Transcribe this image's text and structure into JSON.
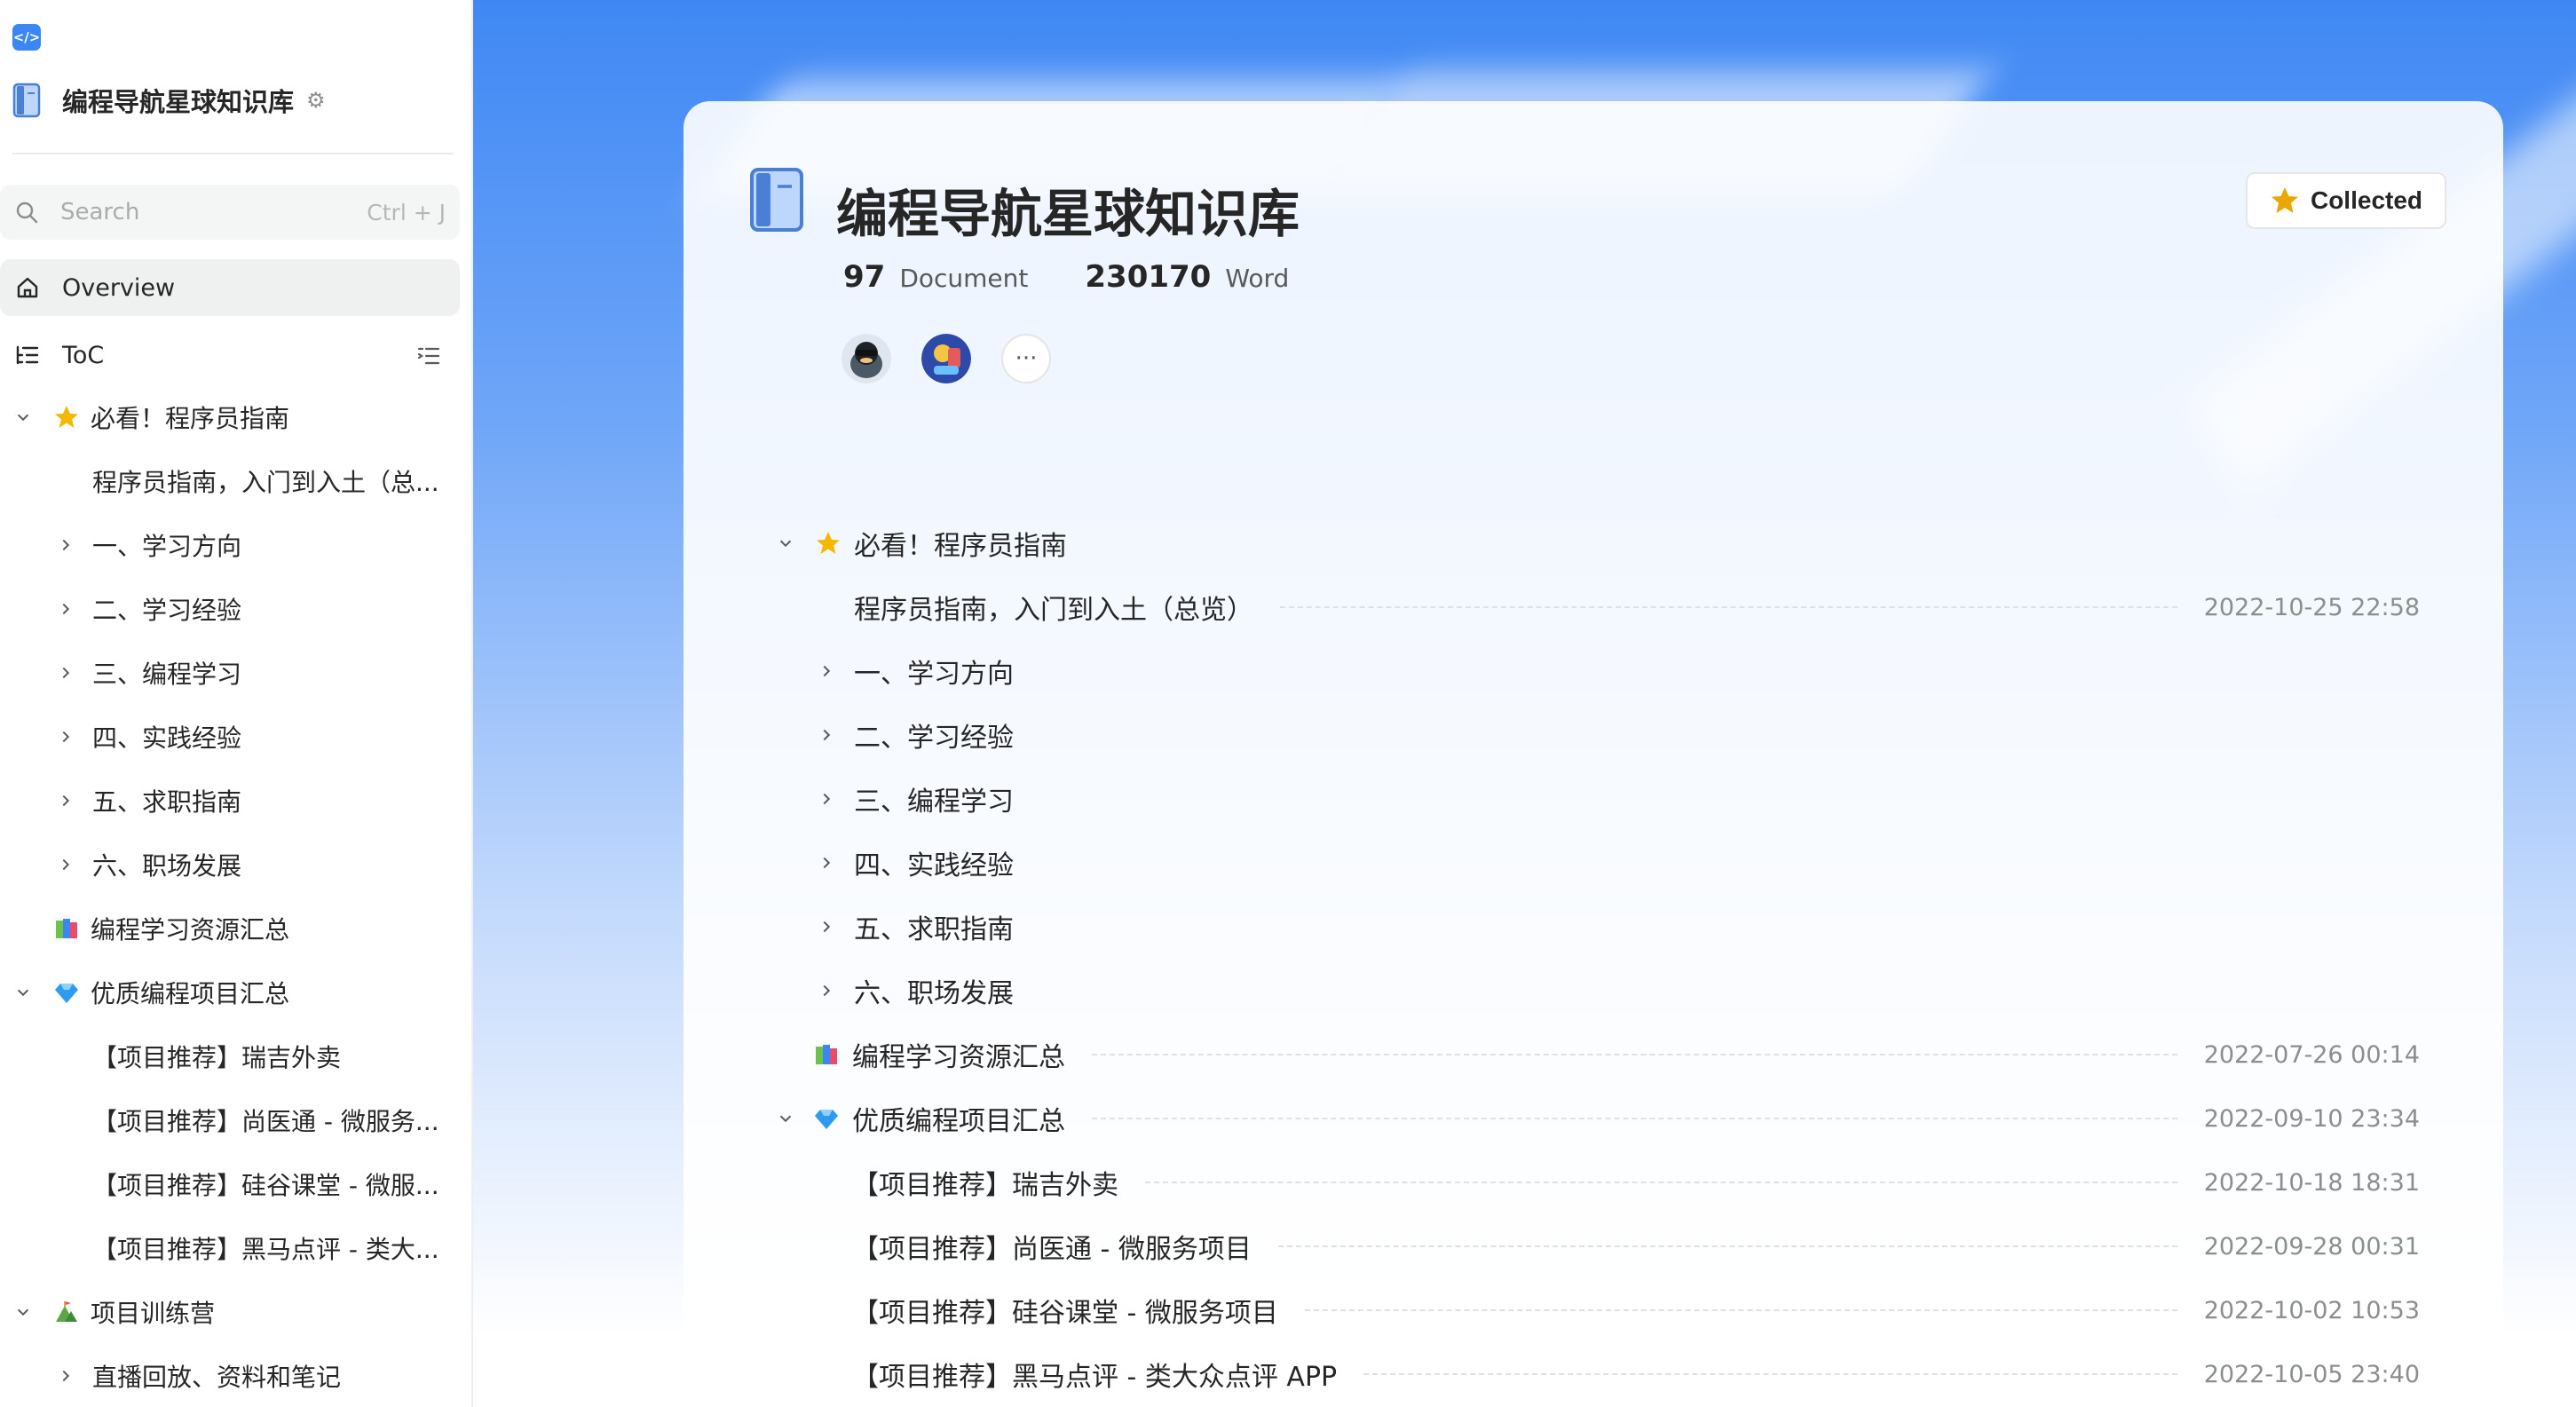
{
  "sidebar": {
    "kb_title": "编程导航星球知识库",
    "search": {
      "placeholder": "Search",
      "shortcut": "Ctrl + J"
    },
    "overview_label": "Overview",
    "toc_label": "ToC",
    "tree": [
      {
        "label": "必看！程序员指南",
        "expanded": true,
        "icon": "star-icon"
      },
      {
        "label": "程序员指南，入门到入土（总..."
      },
      {
        "label": "一、学习方向",
        "collapsed": true
      },
      {
        "label": "二、学习经验",
        "collapsed": true
      },
      {
        "label": "三、编程学习",
        "collapsed": true
      },
      {
        "label": "四、实践经验",
        "collapsed": true
      },
      {
        "label": "五、求职指南",
        "collapsed": true
      },
      {
        "label": "六、职场发展",
        "collapsed": true
      },
      {
        "label": "编程学习资源汇总",
        "icon": "books-icon"
      },
      {
        "label": "优质编程项目汇总",
        "expanded": true,
        "icon": "gem-icon"
      },
      {
        "label": "【项目推荐】瑞吉外卖"
      },
      {
        "label": "【项目推荐】尚医通 - 微服务..."
      },
      {
        "label": "【项目推荐】硅谷课堂 - 微服..."
      },
      {
        "label": "【项目推荐】黑马点评 - 类大..."
      },
      {
        "label": "项目训练营",
        "expanded": true,
        "icon": "camp-icon"
      },
      {
        "label": "直播回放、资料和笔记",
        "collapsed": true
      }
    ]
  },
  "main": {
    "title": "编程导航星球知识库",
    "collected_label": "Collected",
    "stats": {
      "documents": "97",
      "documents_label": "Document",
      "words": "230170",
      "words_label": "Word"
    },
    "more_label": "···",
    "toc": [
      {
        "label": "必看！程序员指南",
        "date": ""
      },
      {
        "label": "程序员指南，入门到入土（总览）",
        "date": "2022-10-25 22:58"
      },
      {
        "label": "一、学习方向",
        "date": ""
      },
      {
        "label": "二、学习经验",
        "date": ""
      },
      {
        "label": "三、编程学习",
        "date": ""
      },
      {
        "label": "四、实践经验",
        "date": ""
      },
      {
        "label": "五、求职指南",
        "date": ""
      },
      {
        "label": "六、职场发展",
        "date": ""
      },
      {
        "label": "编程学习资源汇总",
        "date": "2022-07-26 00:14"
      },
      {
        "label": "优质编程项目汇总",
        "date": "2022-09-10 23:34"
      },
      {
        "label": "【项目推荐】瑞吉外卖",
        "date": "2022-10-18 18:31"
      },
      {
        "label": "【项目推荐】尚医通 - 微服务项目",
        "date": "2022-09-28 00:31"
      },
      {
        "label": "【项目推荐】硅谷课堂 - 微服务项目",
        "date": "2022-10-02 10:53"
      },
      {
        "label": "【项目推荐】黑马点评 - 类大众点评 APP",
        "date": "2022-10-05 23:40"
      }
    ]
  },
  "colors": {
    "accent": "#3a86f5",
    "star": "#f5b800",
    "gem": "#2f9bf0"
  }
}
